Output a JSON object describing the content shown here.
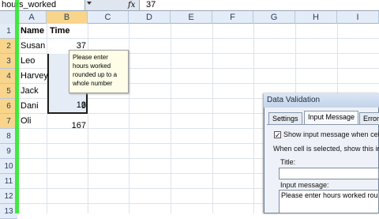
{
  "formula_bar": {
    "name_box": "hours_worked",
    "fx": "fx",
    "formula": "37"
  },
  "columns": [
    "A",
    "B",
    "C",
    "D",
    "E",
    "F",
    "G",
    "H",
    "I"
  ],
  "rows": [
    "1",
    "2",
    "3",
    "4",
    "5",
    "6",
    "7",
    "8",
    "9",
    "10",
    "11",
    "12",
    "13"
  ],
  "cells": {
    "a1": "Name",
    "b1": "Time",
    "a2": "Susan",
    "b2": "37",
    "a3": "Leo",
    "a4": "Harvey",
    "a5": "Jack",
    "a6": "Dani",
    "b6": "9",
    "a7": "Oli",
    "b7": "13",
    "b9": "167"
  },
  "tooltip": "Please enter hours worked rounded up to a whole number",
  "dialog": {
    "title": "Data Validation",
    "tabs": [
      "Settings",
      "Input Message",
      "Error"
    ],
    "checkbox_label": "Show input message when cell is",
    "when_selected": "When cell is selected, show this input",
    "title_label": "Title:",
    "title_value": "",
    "message_label": "Input message:",
    "message_value": "Please enter hours worked rounded"
  },
  "colors": {
    "selection": "#f8d58b",
    "green_marker": "#2ee82e",
    "header": "#e4ecf7"
  }
}
